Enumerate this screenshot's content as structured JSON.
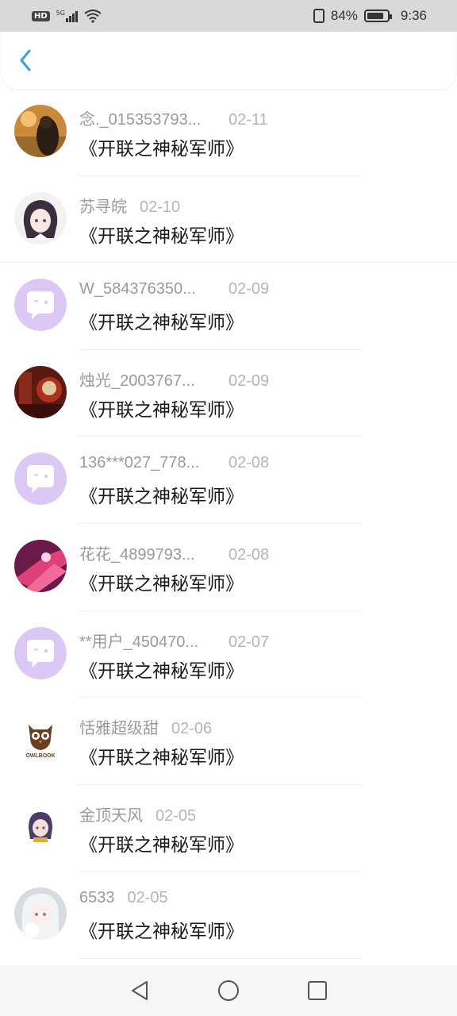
{
  "status_bar": {
    "hd": "HD",
    "network": "5G",
    "battery": "84%",
    "battery_level": 0.84,
    "time": "9:36"
  },
  "header": {
    "back_icon": "chevron-left-icon",
    "accent": "#3aa0d8"
  },
  "items": [
    {
      "user": "念._015353793...",
      "date": "02-11",
      "title": "《开联之神秘军师》",
      "avatar": "photo-girl-warm"
    },
    {
      "user": "苏寻皖",
      "date": "02-10",
      "title": "《开联之神秘军师》",
      "avatar": "anime-girl"
    },
    {
      "user": "W_584376350...",
      "date": "02-09",
      "title": "《开联之神秘军师》",
      "avatar": "default-chat"
    },
    {
      "user": "烛光_2003767...",
      "date": "02-09",
      "title": "《开联之神秘军师》",
      "avatar": "photo-red"
    },
    {
      "user": "136***027_778...",
      "date": "02-08",
      "title": "《开联之神秘军师》",
      "avatar": "default-chat"
    },
    {
      "user": "花花_4899793...",
      "date": "02-08",
      "title": "《开联之神秘军师》",
      "avatar": "photo-pink"
    },
    {
      "user": "**用户_450470...",
      "date": "02-07",
      "title": "《开联之神秘军师》",
      "avatar": "default-chat"
    },
    {
      "user": "恬雅超级甜",
      "date": "02-06",
      "title": "《开联之神秘军师》",
      "avatar": "owlbook-logo"
    },
    {
      "user": "金顶天风",
      "date": "02-05",
      "title": "《开联之神秘军师》",
      "avatar": "anime-small"
    },
    {
      "user": "6533",
      "date": "02-05",
      "title": "《开联之神秘军师》",
      "avatar": "anime-white-hair"
    }
  ],
  "owlbook_text": "OWLBOOK",
  "colors": {
    "default_avatar_bg": "#dcc8f5",
    "username": "#9a9a9a",
    "date": "#b5b5b5",
    "title": "#1a1a1a"
  },
  "nav": {
    "back": "triangle-back-icon",
    "home": "circle-home-icon",
    "recents": "square-recents-icon"
  }
}
